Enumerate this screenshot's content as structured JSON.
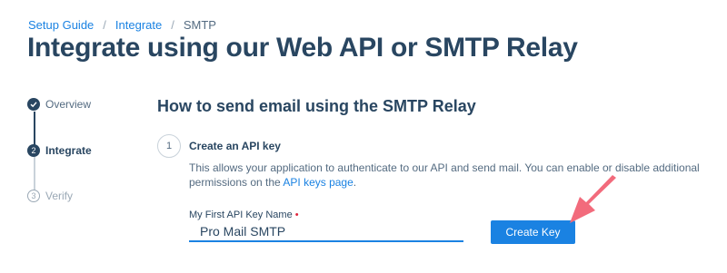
{
  "breadcrumb": {
    "items": [
      "Setup Guide",
      "Integrate",
      "SMTP"
    ],
    "separator": "/"
  },
  "page": {
    "title": "Integrate using our Web API or SMTP Relay"
  },
  "stepper": {
    "steps": [
      {
        "label": "Overview",
        "number": "",
        "state": "complete"
      },
      {
        "label": "Integrate",
        "number": "2",
        "state": "active"
      },
      {
        "label": "Verify",
        "number": "3",
        "state": "pending"
      }
    ]
  },
  "section": {
    "title": "How to send email using the SMTP Relay"
  },
  "step": {
    "number": "1",
    "heading": "Create an API key",
    "description": "This allows your application to authenticate to our API and send mail. You can enable or disable additional permissions on the",
    "link_text": "API keys page",
    "description_end": "."
  },
  "form": {
    "label": "My First API Key Name",
    "required_mark": "•",
    "value": "Pro Mail SMTP",
    "button_label": "Create Key"
  },
  "colors": {
    "brand_blue": "#1a82e2",
    "navy": "#294661",
    "arrow": "#f26b7c"
  }
}
